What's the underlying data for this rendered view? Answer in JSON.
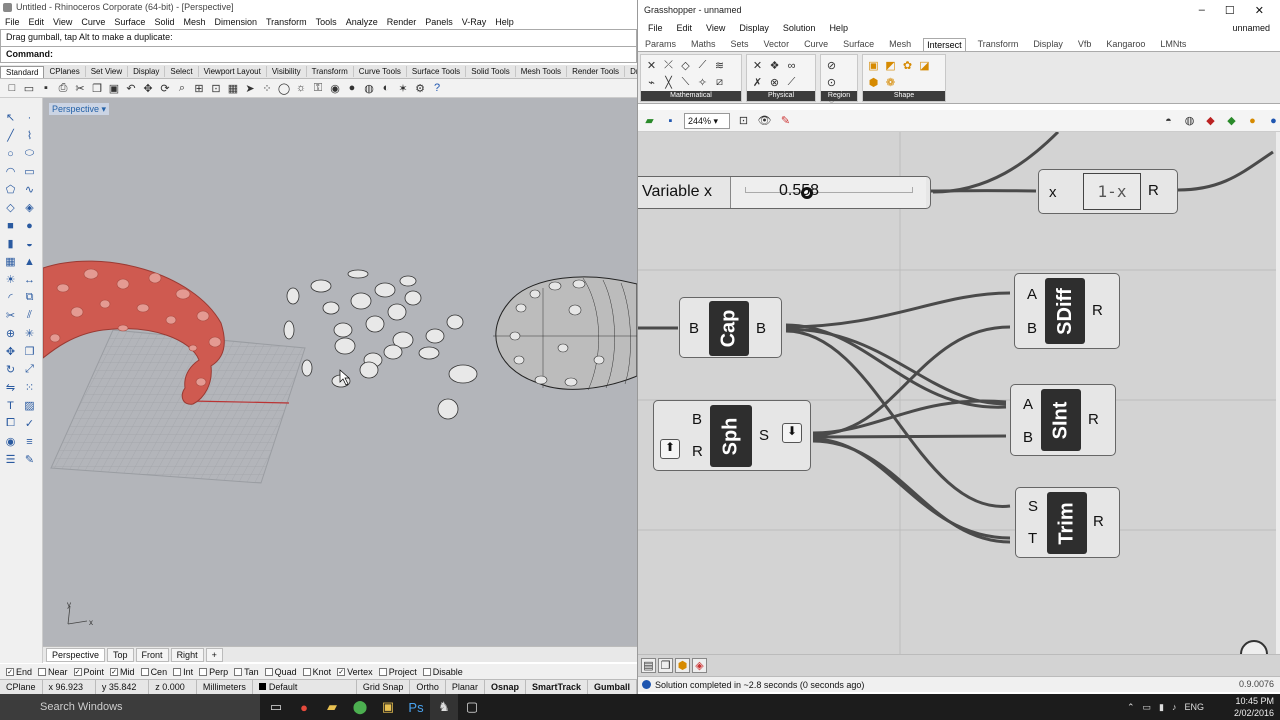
{
  "rhino": {
    "title": "Untitled - Rhinoceros Corporate (64-bit) - [Perspective]",
    "menu": [
      "File",
      "Edit",
      "View",
      "Curve",
      "Surface",
      "Solid",
      "Mesh",
      "Dimension",
      "Transform",
      "Tools",
      "Analyze",
      "Render",
      "Panels",
      "V-Ray",
      "Help"
    ],
    "command_history": "Drag gumball, tap Alt to make a duplicate:",
    "command_prompt": "Command:",
    "toolbar_tabs": [
      "Standard",
      "CPlanes",
      "Set View",
      "Display",
      "Select",
      "Viewport Layout",
      "Visibility",
      "Transform",
      "Curve Tools",
      "Surface Tools",
      "Solid Tools",
      "Mesh Tools",
      "Render Tools",
      "Drafting"
    ],
    "active_toolbar_tab": "Standard",
    "viewport_label": "Perspective",
    "viewport_tabs": [
      "Perspective",
      "Top",
      "Front",
      "Right"
    ],
    "viewport_add": "+",
    "axis_labels": {
      "x": "x",
      "y": "y"
    },
    "osnaps": [
      {
        "label": "End",
        "checked": true
      },
      {
        "label": "Near",
        "checked": false
      },
      {
        "label": "Point",
        "checked": true
      },
      {
        "label": "Mid",
        "checked": true
      },
      {
        "label": "Cen",
        "checked": false
      },
      {
        "label": "Int",
        "checked": false
      },
      {
        "label": "Perp",
        "checked": false
      },
      {
        "label": "Tan",
        "checked": false
      },
      {
        "label": "Quad",
        "checked": false
      },
      {
        "label": "Knot",
        "checked": false
      },
      {
        "label": "Vertex",
        "checked": true
      },
      {
        "label": "Project",
        "checked": false
      },
      {
        "label": "Disable",
        "checked": false
      }
    ],
    "status": {
      "cplane": "CPlane",
      "x": "x 96.923",
      "y": "y 35.842",
      "z": "z 0.000",
      "units": "Millimeters",
      "layer": "Default",
      "grid_snap": "Grid Snap",
      "ortho": "Ortho",
      "planar": "Planar",
      "osnap": "Osnap",
      "smarttrack": "SmartTrack",
      "gumball": "Gumball"
    }
  },
  "gh": {
    "title": "Grasshopper - unnamed",
    "menu": [
      "File",
      "Edit",
      "View",
      "Display",
      "Solution",
      "Help"
    ],
    "doc_name": "unnamed",
    "tabs": [
      "Params",
      "Maths",
      "Sets",
      "Vector",
      "Curve",
      "Surface",
      "Mesh",
      "Intersect",
      "Transform",
      "Display",
      "Vfb",
      "Kangaroo",
      "LMNts"
    ],
    "active_tab": "Intersect",
    "ribbon_groups": [
      "Mathematical",
      "Physical",
      "Region",
      "Shape"
    ],
    "zoom": "244%",
    "components": {
      "slider": {
        "name": "Variable x",
        "value": "0.558",
        "fraction": 0.37
      },
      "expr": {
        "input": "x",
        "expression": "1-x",
        "output": "R"
      },
      "cap": {
        "nickname": "Cap",
        "input": "B",
        "output": "B"
      },
      "sph": {
        "nickname": "Sph",
        "inputs": [
          "B",
          "R"
        ],
        "output": "S"
      },
      "sdiff": {
        "nickname": "SDiff",
        "inputs": [
          "A",
          "B"
        ],
        "output": "R"
      },
      "sint": {
        "nickname": "SInt",
        "inputs": [
          "A",
          "B"
        ],
        "output": "R"
      },
      "trim": {
        "nickname": "Trim",
        "inputs": [
          "S",
          "T"
        ],
        "output": "R"
      }
    },
    "solution_status": "Solution completed in ~2.8 seconds (0 seconds ago)",
    "version": "0.9.0076"
  },
  "taskbar": {
    "search": "Search Windows",
    "lang": "ENG",
    "time": "10:45 PM",
    "date": "2/02/2016"
  },
  "colors": {
    "rhino_shape": "#cf5a50",
    "viewport_bg": "#b3b5ba",
    "gh_canvas": "#d3d3d3",
    "component": "#e6e6e6",
    "nickname_bg": "#2e2e2e",
    "wire": "#4a4a4a"
  }
}
